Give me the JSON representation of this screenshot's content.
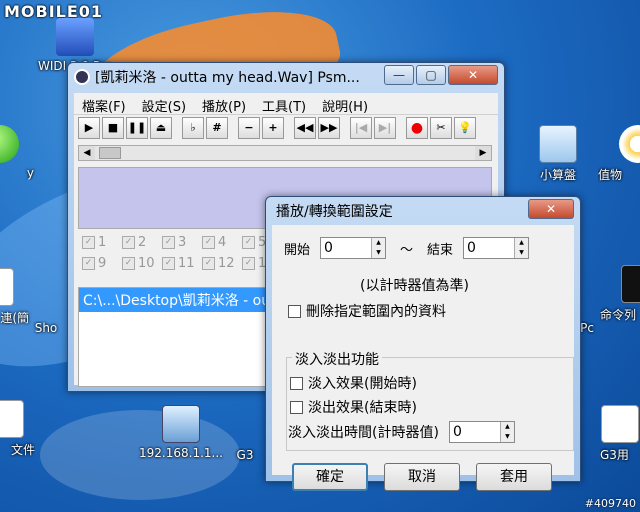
{
  "watermark": {
    "brand": "MOBILE01",
    "post_id": "#409740"
  },
  "desktop_icons": [
    {
      "label": "WIDI 3.0 Pro",
      "icon": "app-icon"
    },
    {
      "label": "y",
      "icon": "green-ball-icon"
    },
    {
      "label": "小算盤",
      "icon": "calculator-icon"
    },
    {
      "label": "值物",
      "icon": "flower-icon"
    },
    {
      "label": "連(簡",
      "icon": "document-icon"
    },
    {
      "label": "Sho",
      "icon": "shortcut-icon"
    },
    {
      "label": "Pc",
      "icon": "app-icon"
    },
    {
      "label": "命令列",
      "icon": "cmd-icon"
    },
    {
      "label": "192.168.1.1...",
      "icon": "network-icon"
    },
    {
      "label": "G3",
      "icon": "app-icon"
    },
    {
      "label": "文件",
      "icon": "document-icon"
    },
    {
      "label": "G3用",
      "icon": "app-icon"
    }
  ],
  "psm_window": {
    "title": "[凱莉米洛 - outta my head.Wav] Psm...",
    "menu": [
      "檔案(F)",
      "設定(S)",
      "播放(P)",
      "工具(T)",
      "說明(H)"
    ],
    "toolbar": [
      {
        "name": "play-icon",
        "glyph": "▶"
      },
      {
        "name": "stop-icon",
        "glyph": "■"
      },
      {
        "name": "pause-icon",
        "glyph": "❚❚"
      },
      {
        "name": "eject-icon",
        "glyph": "⏏"
      },
      {
        "name": "flat-icon",
        "glyph": "♭",
        "gap": true
      },
      {
        "name": "sharp-icon",
        "glyph": "#"
      },
      {
        "name": "minus-icon",
        "glyph": "−",
        "gap": true
      },
      {
        "name": "plus-icon",
        "glyph": "+"
      },
      {
        "name": "rewind-icon",
        "glyph": "◀◀",
        "gap": true
      },
      {
        "name": "fast-forward-icon",
        "glyph": "▶▶"
      },
      {
        "name": "prev-track-icon",
        "glyph": "|◀",
        "gap": true,
        "dim": true
      },
      {
        "name": "next-track-icon",
        "glyph": "▶|",
        "dim": true
      },
      {
        "name": "record-icon",
        "glyph": "●",
        "gap": true,
        "red": true
      },
      {
        "name": "scissors-icon",
        "glyph": "✂"
      },
      {
        "name": "bulb-icon",
        "glyph": "💡"
      }
    ],
    "tracks": [
      "1",
      "2",
      "3",
      "4",
      "5",
      "9",
      "10",
      "11",
      "12",
      "1"
    ],
    "file": "C:\\...\\Desktop\\凱莉米洛 - outta my head.Wav"
  },
  "dialog": {
    "title": "播放/轉換範圍設定",
    "start_label": "開始",
    "start_value": "0",
    "tilde": "～",
    "end_label": "結束",
    "end_value": "0",
    "note": "(以計時器值為準)",
    "delete_label": "刪除指定範圍內的資料",
    "fade_group": "淡入淡出功能",
    "fade_in_label": "淡入效果(開始時)",
    "fade_out_label": "淡出效果(結束時)",
    "fade_time_label": "淡入淡出時間(計時器值)",
    "fade_time_value": "0",
    "ok_label": "確定",
    "cancel_label": "取消",
    "apply_label": "套用"
  }
}
